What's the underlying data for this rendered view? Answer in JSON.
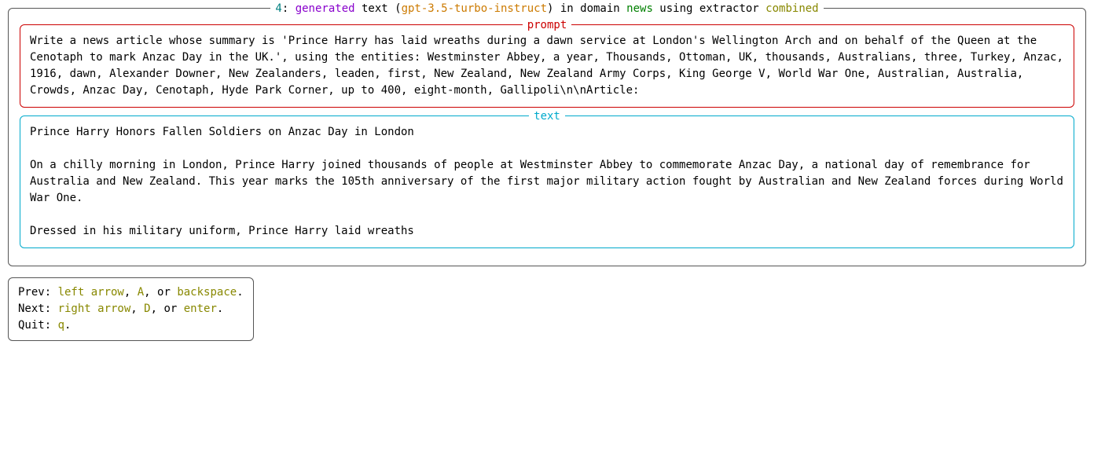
{
  "header": {
    "index": "4",
    "generated_word": "generated",
    "text_word": " text (",
    "model": "gpt-3.5-turbo-instruct",
    "in_domain": ") in domain ",
    "domain": "news",
    "using_extractor": " using extractor ",
    "extractor": "combined"
  },
  "prompt": {
    "label": "prompt",
    "body": "Write a news article whose summary is 'Prince Harry has laid wreaths during a dawn service at London's Wellington Arch and on behalf of the Queen at the Cenotaph to mark Anzac Day in the UK.', using the entities: Westminster Abbey, a year, Thousands, Ottoman, UK, thousands, Australians, three, Turkey, Anzac, 1916, dawn, Alexander Downer, New Zealanders, leaden, first, New Zealand, New Zealand Army Corps, King George V, World War One, Australian, Australia, Crowds, Anzac Day, Cenotaph, Hyde Park Corner, up to 400, eight-month, Gallipoli\\n\\nArticle:"
  },
  "text": {
    "label": "text",
    "body": "Prince Harry Honors Fallen Soldiers on Anzac Day in London\n\nOn a chilly morning in London, Prince Harry joined thousands of people at Westminster Abbey to commemorate Anzac Day, a national day of remembrance for Australia and New Zealand. This year marks the 105th anniversary of the first major military action fought by Australian and New Zealand forces during World War One.\n\nDressed in his military uniform, Prince Harry laid wreaths"
  },
  "help": {
    "prev_label": "Prev: ",
    "prev_keys1": "left arrow",
    "prev_sep1": ", ",
    "prev_keys2": "A",
    "prev_sep2": ", or ",
    "prev_keys3": "backspace",
    "prev_end": ".",
    "next_label": "Next: ",
    "next_keys1": "right arrow",
    "next_sep1": ", ",
    "next_keys2": "D",
    "next_sep2": ", or ",
    "next_keys3": "enter",
    "next_end": ".",
    "quit_label": "Quit: ",
    "quit_key": "q",
    "quit_end": "."
  }
}
